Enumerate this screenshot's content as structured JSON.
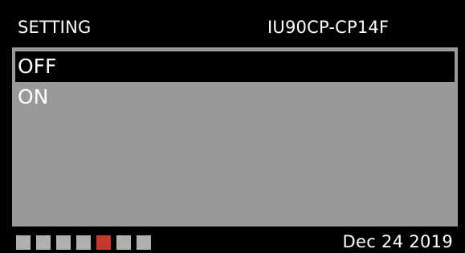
{
  "header": {
    "title": "SETTING",
    "model": "IU90CP-CP14F"
  },
  "options": [
    {
      "label": "OFF",
      "selected": true
    },
    {
      "label": "ON",
      "selected": false
    }
  ],
  "footer": {
    "page_count": 7,
    "active_page": 5,
    "date": "Dec 24 2019"
  },
  "colors": {
    "background": "#000000",
    "panel": "#999999",
    "selection": "#000000",
    "pager_inactive": "#b0b0b0",
    "pager_active": "#c0392b",
    "text": "#ffffff"
  }
}
